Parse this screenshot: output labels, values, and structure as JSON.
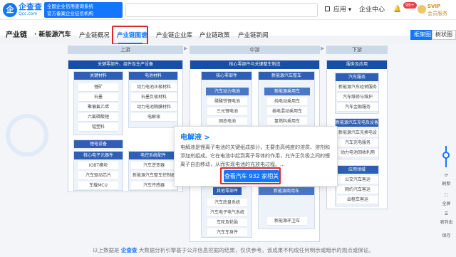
{
  "app": {
    "logo_mark": "企",
    "logo_name": "企查查",
    "logo_url": "Qcc.com",
    "slogan_line1": "全国企业信用查询系统",
    "slogan_line2": "官方备案企业征信机构"
  },
  "topbar": {
    "apps_label": "应用",
    "company_center": "企业中心",
    "notif_count": "99+",
    "vip_label": "SVIP",
    "vip_sub": "会员服务"
  },
  "page": {
    "section": "产业链",
    "subject": "· 新能源汽车"
  },
  "tabs": [
    "产业链概况",
    "产业链图谱",
    "产业链企业库",
    "产业链政策",
    "产业链新闻"
  ],
  "view_toggle": {
    "graph": "框架图",
    "tree": "树状图"
  },
  "stages": [
    "上游",
    "中游",
    "下游"
  ],
  "upstream": {
    "header": "关键零部件、组件及生产设备",
    "groups": [
      {
        "title": "关键材料",
        "items": [
          "锂矿",
          "石墨",
          "聚偏氟乙烯",
          "六氟磷酸锂",
          "锰塑料"
        ]
      },
      {
        "title": "电池材料",
        "items": [
          "动力电池正极材料",
          "石墨负极材料",
          "动力电池隔膜材料",
          "电解液"
        ]
      },
      {
        "title": "锂电设备",
        "items": []
      },
      {
        "title": "核心电子元器件",
        "items": [
          "IGBT模块",
          "汽车驱动芯片",
          "车载MCU"
        ]
      },
      {
        "title": "电控系统配件",
        "items": [
          "汽车逆变器",
          "新能源汽车整车控制器",
          "汽车传感器"
        ]
      }
    ]
  },
  "midstream": {
    "header": "核心零部件与关键整车制造",
    "groups": [
      {
        "title": "核心零部件",
        "sub": "汽车动力电池",
        "items": [
          "磷酸铁锂电池",
          "三元锂电池",
          "固态电池"
        ]
      },
      {
        "title": "新能源汽车整车",
        "sub": "新能源乘用车",
        "items": [
          "纯电动乘用车",
          "插电混动乘用车",
          "氢燃料乘用车"
        ]
      },
      {
        "title": "其他零部件",
        "items": [
          "汽车底盘系统",
          "汽车电子电气系统",
          "车轮及轮胎",
          "汽车车身件"
        ]
      },
      {
        "title": "新能源商用车",
        "items": [
          "新能源环卫车"
        ]
      }
    ]
  },
  "downstream": {
    "header": "服务及应用",
    "groups": [
      {
        "title": "汽车服务",
        "items": [
          "新能源汽车经销服务",
          "汽车维修与维护",
          "汽车金融服务"
        ]
      },
      {
        "title": "新能源汽车充电及设备",
        "items": [
          "新能源汽车充换电设备",
          "汽车充电服务",
          "动力电池回收利用"
        ]
      },
      {
        "title": "应用领域",
        "items": [
          "公交汽车客运",
          "网约汽车客运",
          "出租车客运"
        ]
      }
    ]
  },
  "popup": {
    "title": "电解液 >",
    "description": "电解液是锂离子电池的关键组成部分，主要由高纯度的溶质、溶剂和添加剂组成。它在电池中起到离子导体的作用，允许正负极之间的锂离子自由移动，从而实现电池的充放电过程。...",
    "button": "查看汽车 932 家相关企业"
  },
  "sidebar": {
    "refresh": "刷新",
    "fullscreen": "全屏",
    "table": "表列出",
    "save": "保存"
  },
  "footer": {
    "prefix": "以上数据是",
    "brand": "企查查",
    "text": "大数据分析引擎基于公开信息挖掘的结果，仅供参考。该成果不构成任何明示或暗示的观点或保证。"
  },
  "colors": {
    "accent": "#1476ff",
    "highlight": "#e0262a",
    "header_navy": "#1b4da6"
  }
}
